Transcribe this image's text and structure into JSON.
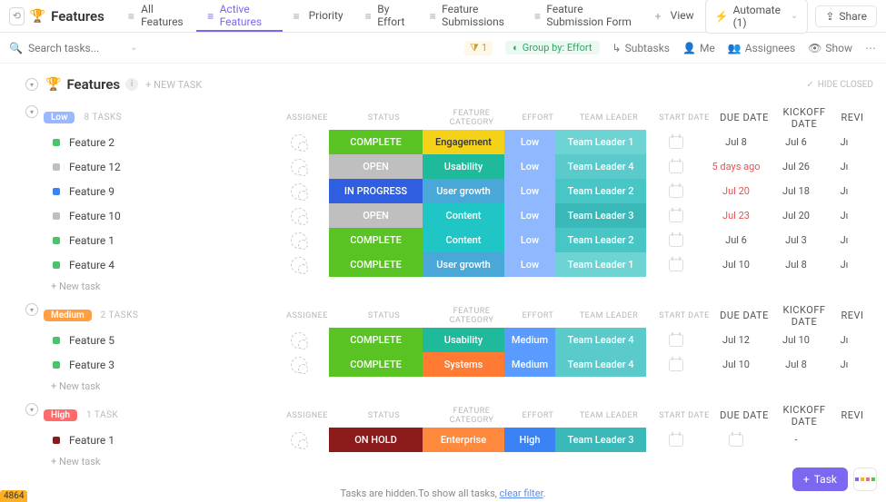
{
  "header": {
    "title": "Features",
    "tabs": [
      {
        "label": "All Features"
      },
      {
        "label": "Active Features",
        "active": true
      },
      {
        "label": "Priority"
      },
      {
        "label": "By Effort"
      },
      {
        "label": "Feature Submissions"
      },
      {
        "label": "Feature Submission Form"
      },
      {
        "label": "View",
        "add": true
      }
    ],
    "automate": "Automate (1)",
    "share": "Share"
  },
  "toolbar": {
    "search_placeholder": "Search tasks...",
    "filter_count": "1",
    "groupby": "Group by: Effort",
    "subtasks": "Subtasks",
    "me": "Me",
    "assignees": "Assignees",
    "show": "Show"
  },
  "list": {
    "title": "Features",
    "newtask": "+ NEW TASK",
    "hide_closed": "HIDE CLOSED",
    "columns": {
      "assignee": "ASSIGNEE",
      "status": "STATUS",
      "cat": "FEATURE CATEGORY",
      "effort": "EFFORT",
      "leader": "TEAM LEADER",
      "start": "START DATE",
      "due": "DUE DATE",
      "kick": "KICKOFF DATE",
      "rev": "REVI"
    },
    "newtask_row": "+ New task"
  },
  "groups": [
    {
      "pill": "Low",
      "pillcls": "low",
      "count": "8 TASKS",
      "rows": [
        {
          "sq": "green",
          "name": "Feature 2",
          "status": "COMPLETE",
          "stcls": "st-complete",
          "cat": "Engagement",
          "catcls": "cat-eng",
          "eff": "Low",
          "effcls": "ef-low",
          "leader": "Team Leader 1",
          "tlcls": "tl-1",
          "due": "Jul 8",
          "kick": "Jul 6",
          "rev": "Jı"
        },
        {
          "sq": "gray",
          "name": "Feature 12",
          "status": "OPEN",
          "stcls": "st-open",
          "cat": "Usability",
          "catcls": "cat-usa",
          "eff": "Low",
          "effcls": "ef-low",
          "leader": "Team Leader 4",
          "tlcls": "tl-4",
          "due": "5 days ago",
          "duered": true,
          "kick": "Jul 26",
          "rev": "Jı"
        },
        {
          "sq": "blue",
          "name": "Feature 9",
          "status": "IN PROGRESS",
          "stcls": "st-progress",
          "cat": "User growth",
          "catcls": "cat-grow",
          "eff": "Low",
          "effcls": "ef-low",
          "leader": "Team Leader 2",
          "tlcls": "tl-2",
          "due": "Jul 20",
          "duered": true,
          "kick": "Jul 18",
          "rev": "Jı"
        },
        {
          "sq": "gray",
          "name": "Feature 10",
          "status": "OPEN",
          "stcls": "st-open",
          "cat": "Content",
          "catcls": "cat-cont",
          "eff": "Low",
          "effcls": "ef-low",
          "leader": "Team Leader 3",
          "tlcls": "tl-3",
          "due": "Jul 23",
          "duered": true,
          "kick": "Jul 20",
          "rev": "Jı"
        },
        {
          "sq": "green",
          "name": "Feature 1",
          "status": "COMPLETE",
          "stcls": "st-complete",
          "cat": "Content",
          "catcls": "cat-cont",
          "eff": "Low",
          "effcls": "ef-low",
          "leader": "Team Leader 2",
          "tlcls": "tl-2",
          "due": "Jul 6",
          "kick": "Jul 3",
          "rev": "Jı"
        },
        {
          "sq": "green",
          "name": "Feature 4",
          "status": "COMPLETE",
          "stcls": "st-complete",
          "cat": "User growth",
          "catcls": "cat-grow",
          "eff": "Low",
          "effcls": "ef-low",
          "leader": "Team Leader 1",
          "tlcls": "tl-1",
          "due": "Jul 10",
          "kick": "Jul 8",
          "rev": "Jı"
        }
      ]
    },
    {
      "pill": "Medium",
      "pillcls": "med",
      "count": "2 TASKS",
      "rows": [
        {
          "sq": "green",
          "name": "Feature 5",
          "status": "COMPLETE",
          "stcls": "st-complete",
          "cat": "Usability",
          "catcls": "cat-usa",
          "eff": "Medium",
          "effcls": "ef-med",
          "leader": "Team Leader 4",
          "tlcls": "tl-4",
          "due": "Jul 12",
          "kick": "Jul 10",
          "rev": "Jı"
        },
        {
          "sq": "green",
          "name": "Feature 3",
          "status": "COMPLETE",
          "stcls": "st-complete",
          "cat": "Systems",
          "catcls": "cat-sys",
          "eff": "Medium",
          "effcls": "ef-med",
          "leader": "Team Leader 4",
          "tlcls": "tl-4",
          "due": "Jul 10",
          "kick": "Jul 8",
          "rev": "Jı"
        }
      ]
    },
    {
      "pill": "High",
      "pillcls": "high",
      "count": "1 TASK",
      "rows": [
        {
          "sq": "dred",
          "name": "Feature 1",
          "status": "ON HOLD",
          "stcls": "st-hold",
          "cat": "Enterprise",
          "catcls": "cat-ent",
          "eff": "High",
          "effcls": "ef-high",
          "leader": "Team Leader 3",
          "tlcls": "tl-3",
          "due": "",
          "kick": "-",
          "rev": ""
        }
      ]
    }
  ],
  "footer": {
    "note": "Tasks are hidden.To show all tasks, ",
    "link": "clear filter",
    "dot": "."
  },
  "fab": "Task",
  "corner": "4864"
}
